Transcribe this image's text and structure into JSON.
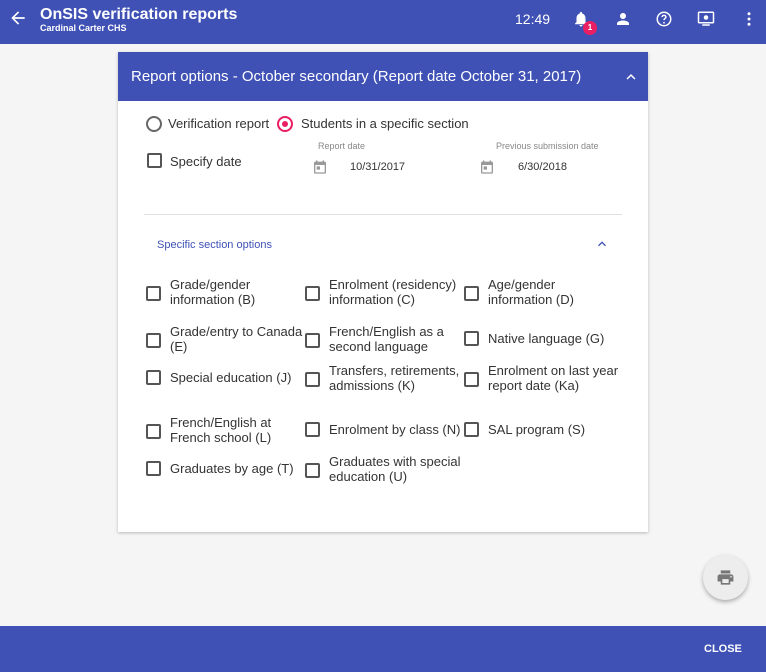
{
  "appbar": {
    "title": "OnSIS verification reports",
    "subtitle": "Cardinal Carter CHS",
    "time": "12:49",
    "notification_count": "1",
    "color": "#3f51b5"
  },
  "card": {
    "title": "Report options - October secondary (Report date October 31, 2017)",
    "report_type": {
      "options": [
        "Verification report",
        "Students in a specific section"
      ],
      "selected": "Students in a specific section"
    },
    "specify_date_label": "Specify date",
    "report_date": {
      "label": "Report date",
      "value": "10/31/2017"
    },
    "previous_submission_date": {
      "label": "Previous submission date",
      "value": "6/30/2018"
    },
    "section_options_title": "Specific section options",
    "sections": [
      {
        "label_lines": [
          "Grade/gender",
          "information (B)"
        ],
        "checked": false
      },
      {
        "label_lines": [
          "Enrolment (residency)",
          "information (C)"
        ],
        "checked": false
      },
      {
        "label_lines": [
          "Age/gender",
          "information (D)"
        ],
        "checked": false
      },
      {
        "label_lines": [
          "Grade/entry to Canada",
          "(E)"
        ],
        "checked": false
      },
      {
        "label_lines": [
          "French/English as a",
          "second language"
        ],
        "checked": false
      },
      {
        "label_lines": [
          "Native language (G)"
        ],
        "checked": false
      },
      {
        "label_lines": [
          "Special education (J)"
        ],
        "checked": false
      },
      {
        "label_lines": [
          "Transfers, retirements,",
          "admissions (K)"
        ],
        "checked": false
      },
      {
        "label_lines": [
          "Enrolment on last year",
          "report date (Ka)"
        ],
        "checked": false
      },
      {
        "label_lines": [
          "French/English at",
          "French school (L)"
        ],
        "checked": false
      },
      {
        "label_lines": [
          "Enrolment by class (N)"
        ],
        "checked": false
      },
      {
        "label_lines": [
          "SAL program (S)"
        ],
        "checked": false
      },
      {
        "label_lines": [
          "Graduates by age (T)"
        ],
        "checked": false
      },
      {
        "label_lines": [
          "Graduates with special",
          "education (U)"
        ],
        "checked": false
      }
    ]
  },
  "footer": {
    "close_label": "CLOSE"
  },
  "colors": {
    "primary": "#3f51b5",
    "accent": "#e91e63"
  }
}
